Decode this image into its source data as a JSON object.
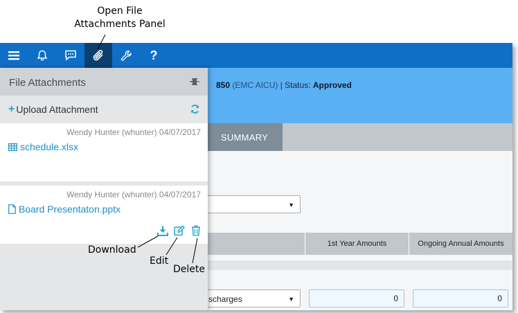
{
  "callouts": {
    "open_panel_line1": "Open File",
    "open_panel_line2": "Attachments Panel",
    "download": "Download",
    "edit": "Edit",
    "delete": "Delete"
  },
  "header": {
    "project_code": "850",
    "project_sub": "(EMC AICU)",
    "status_label": "| Status:",
    "status_value": "Approved"
  },
  "tabs": {
    "summary": "SUMMARY"
  },
  "table": {
    "col_first_year": "1st Year Amounts",
    "col_ongoing": "Ongoing Annual Amounts",
    "row_select_text": "scharges",
    "first_year_value": "0",
    "ongoing_value": "0"
  },
  "panel": {
    "title": "File Attachments",
    "upload_label": "Upload Attachment",
    "files": [
      {
        "meta": "Wendy Hunter (whunter) 04/07/2017",
        "name": "schedule.xlsx",
        "icon": "spreadsheet-icon"
      },
      {
        "meta": "Wendy Hunter (whunter) 04/07/2017",
        "name": "Board Presentaton.pptx",
        "icon": "document-icon"
      }
    ]
  },
  "colors": {
    "topbar": "#0f6fc6",
    "topbar_active": "#0a3f6e",
    "header": "#5bb0f3",
    "accent": "#1ea8cc",
    "link": "#1a8fc6"
  }
}
